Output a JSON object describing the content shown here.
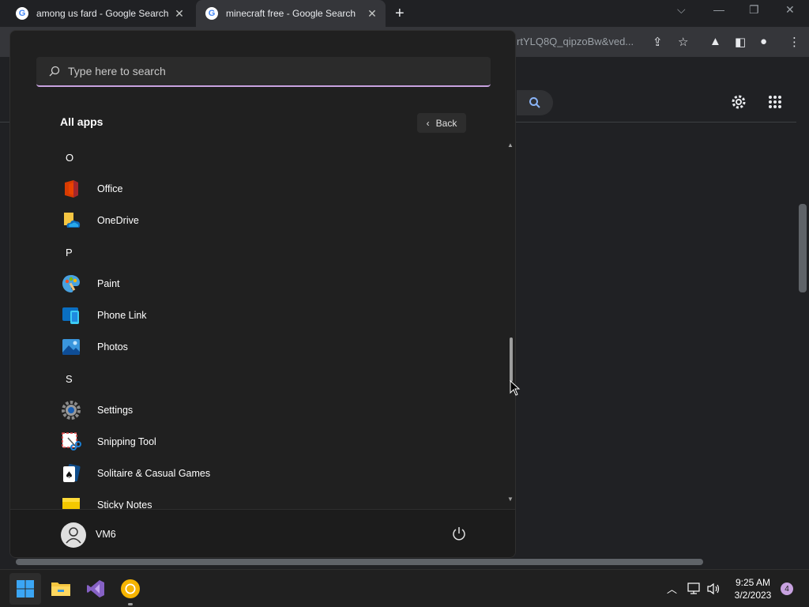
{
  "browser": {
    "tabs": [
      {
        "title": "among us fard - Google Search",
        "favicon": "G"
      },
      {
        "title": "minecraft free - Google Search",
        "favicon": "G"
      }
    ],
    "url_fragment": "rtYLQ8Q_qipzoBw&ved...",
    "new_tab_glyph": "+",
    "close_glyph": "✕"
  },
  "start_menu": {
    "search_placeholder": "Type here to search",
    "heading": "All apps",
    "back_label": "Back",
    "sections": [
      {
        "letter": "O",
        "apps": [
          "Office",
          "OneDrive"
        ]
      },
      {
        "letter": "P",
        "apps": [
          "Paint",
          "Phone Link",
          "Photos"
        ]
      },
      {
        "letter": "S",
        "apps": [
          "Settings",
          "Snipping Tool",
          "Solitaire & Casual Games",
          "Sticky Notes"
        ]
      }
    ],
    "user": "VM6",
    "icons": {
      "Office": "office-icon",
      "OneDrive": "onedrive-icon",
      "Paint": "paint-icon",
      "Phone Link": "phone-link-icon",
      "Photos": "photos-icon",
      "Settings": "settings-icon",
      "Snipping Tool": "snipping-tool-icon",
      "Solitaire & Casual Games": "solitaire-icon",
      "Sticky Notes": "sticky-notes-icon"
    }
  },
  "taskbar": {
    "time": "9:25 AM",
    "date": "3/2/2023",
    "notification_count": "4",
    "pinned": [
      "start-button",
      "file-explorer",
      "visual-studio",
      "chrome-canary"
    ]
  },
  "colors": {
    "accent": "#c8a2e0",
    "menu_bg": "#202020",
    "browser_bg": "#202124"
  }
}
